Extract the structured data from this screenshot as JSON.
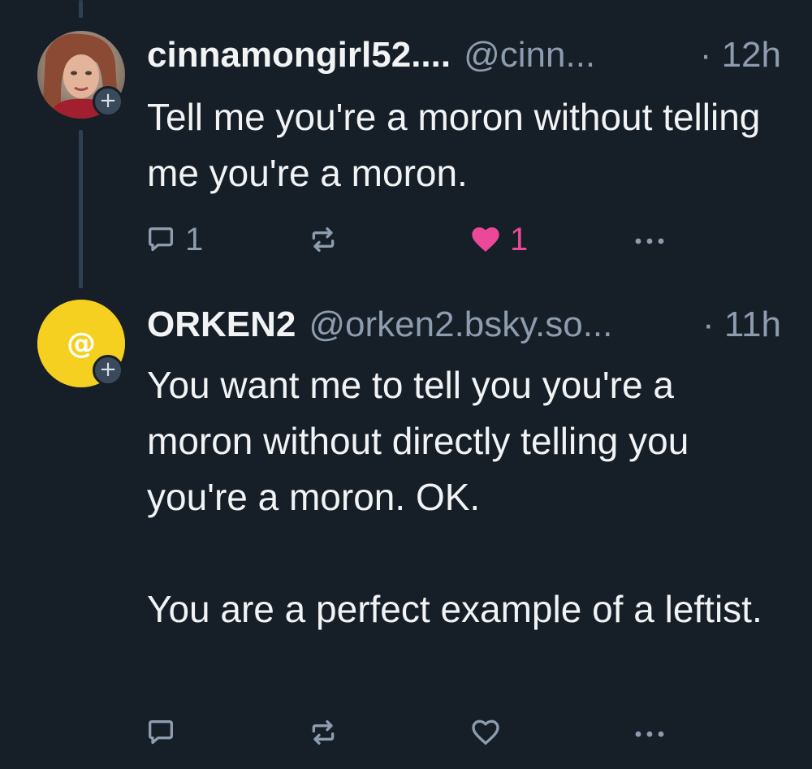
{
  "posts": [
    {
      "display_name": "cinnamongirl52....",
      "handle": "@cinn...",
      "time": "· 12h",
      "text": "Tell me you're a moron without telling me you're a moron.",
      "follow_badge": "+",
      "reply_count": "1",
      "like_count": "1",
      "liked": true,
      "avatar": "profile-photo"
    },
    {
      "display_name": "ORKEN2",
      "handle": "@orken2.bsky.so...",
      "time": "· 11h",
      "text": "You want me to tell you you're a moron without directly telling you you're a moron. OK.\n\nYou are a perfect example of a leftist.",
      "follow_badge": "+",
      "avatar_glyph": "@",
      "avatar_color": "#f5d020",
      "liked": false
    }
  ],
  "colors": {
    "background": "#161e27",
    "text": "#f1f3f5",
    "muted": "#8d9cae",
    "like": "#ec4899",
    "thread_line": "#2e4052"
  },
  "icons": [
    "reply-icon",
    "repost-icon",
    "like-icon",
    "more-icon"
  ]
}
